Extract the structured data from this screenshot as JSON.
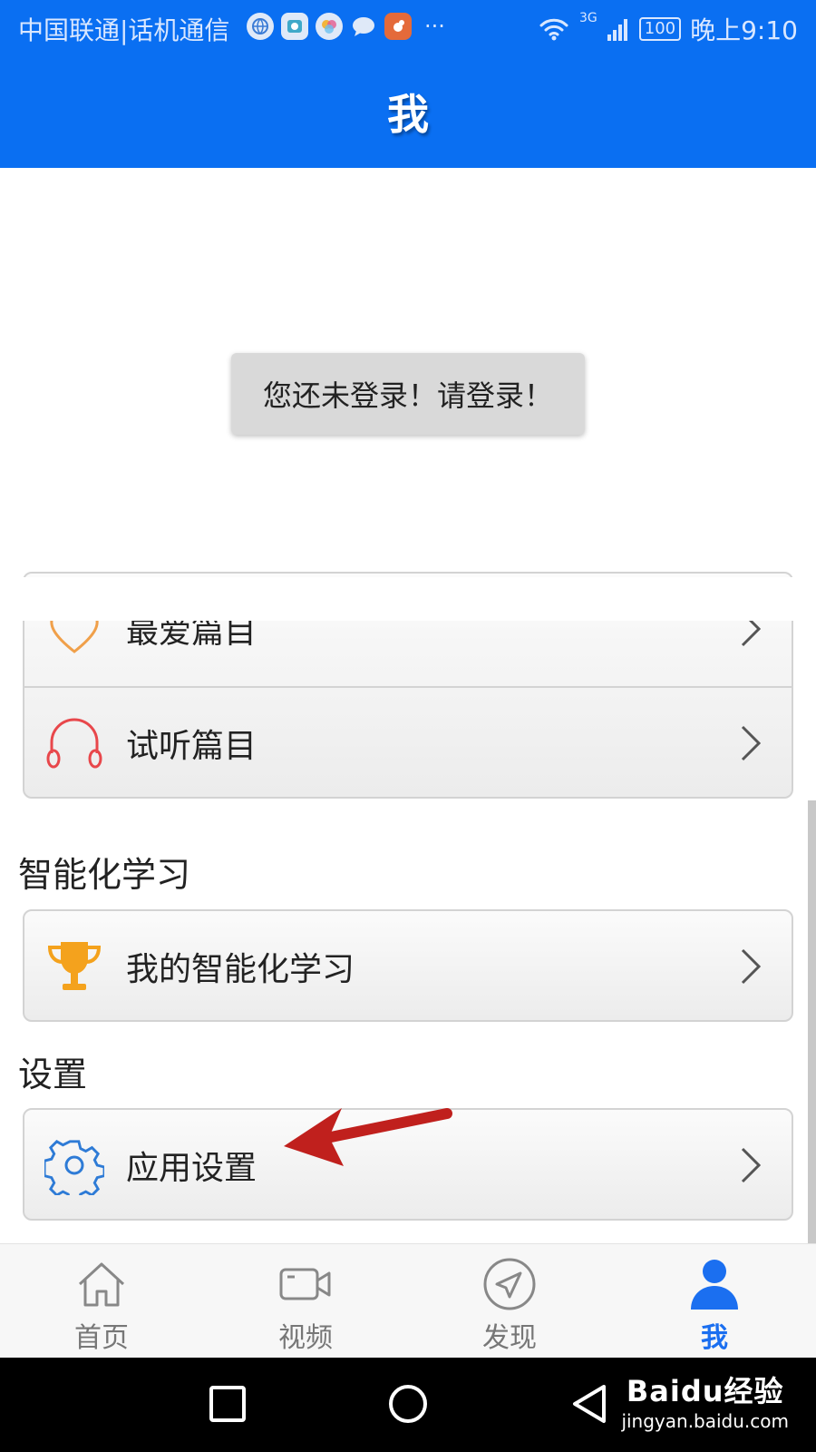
{
  "status_bar": {
    "carrier": "中国联通|话机通信",
    "more": "···",
    "network": "3G",
    "battery": "100",
    "time": "晚上9:10"
  },
  "header": {
    "title": "我"
  },
  "toast": {
    "text": "您还未登录！请登录！"
  },
  "my_items": [
    {
      "label": "最爱篇目",
      "icon": "heart-icon"
    },
    {
      "label": "试听篇目",
      "icon": "headphones-icon"
    }
  ],
  "smart_learning": {
    "title": "智能化学习",
    "item": {
      "label": "我的智能化学习",
      "icon": "trophy-icon"
    }
  },
  "settings": {
    "title": "设置",
    "item": {
      "label": "应用设置",
      "icon": "gear-icon"
    }
  },
  "tabbar": {
    "tabs": [
      {
        "label": "首页",
        "icon": "home-icon"
      },
      {
        "label": "视频",
        "icon": "video-icon"
      },
      {
        "label": "发现",
        "icon": "compass-icon"
      },
      {
        "label": "我",
        "icon": "user-icon",
        "active": true
      }
    ]
  },
  "watermark": {
    "brand": "Baidu经验",
    "url": "jingyan.baidu.com"
  },
  "colors": {
    "header_bg": "#0a6ff2",
    "tab_active": "#1b6ff0",
    "annotation_arrow": "#c0201d",
    "heart": "#f0a04a",
    "headphones": "#e8474b",
    "trophy": "#f4a21d",
    "gear": "#2e7bd6"
  }
}
